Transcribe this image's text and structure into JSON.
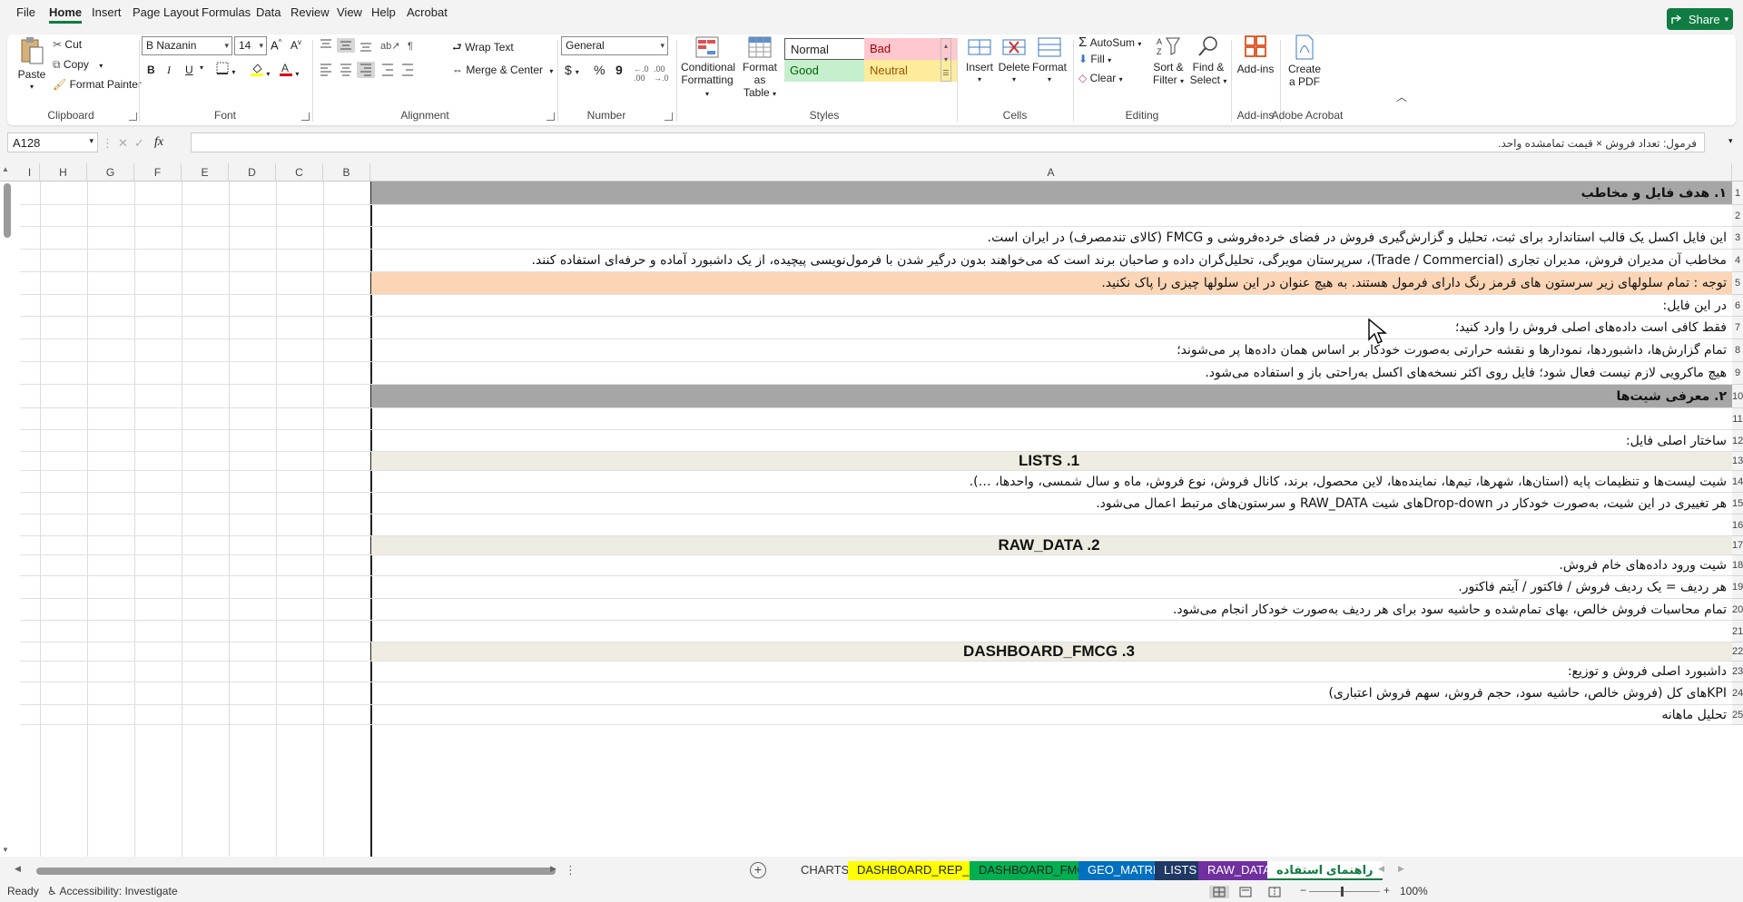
{
  "menu": [
    "File",
    "Home",
    "Insert",
    "Page Layout",
    "Formulas",
    "Data",
    "Review",
    "View",
    "Help",
    "Acrobat"
  ],
  "share_label": "Share",
  "ribbon": {
    "clipboard": {
      "paste": "Paste",
      "cut": "Cut",
      "copy": "Copy",
      "format_painter": "Format Painter",
      "label": "Clipboard"
    },
    "font": {
      "name": "B Nazanin",
      "size": "14",
      "bold": "B",
      "italic": "I",
      "underline": "U",
      "label": "Font"
    },
    "alignment": {
      "wrap": "Wrap Text",
      "merge": "Merge & Center",
      "label": "Alignment"
    },
    "number": {
      "format": "General",
      "currency": "$",
      "percent": "%",
      "comma": "9",
      "label": "Number"
    },
    "styles": {
      "conditional": [
        "Conditional",
        "Formatting"
      ],
      "format_table": [
        "Format as",
        "Table"
      ],
      "normal": "Normal",
      "bad": "Bad",
      "good": "Good",
      "neutral": "Neutral",
      "label": "Styles"
    },
    "cells": {
      "insert": "Insert",
      "delete": "Delete",
      "format": "Format",
      "label": "Cells"
    },
    "editing": {
      "autosum": "AutoSum",
      "fill": "Fill",
      "clear": "Clear",
      "sort": [
        "Sort &",
        "Filter"
      ],
      "find": [
        "Find &",
        "Select"
      ],
      "label": "Editing"
    },
    "addins": {
      "button": "Add-ins",
      "label": "Add-ins"
    },
    "acrobat": {
      "button": [
        "Create",
        "a PDF"
      ],
      "label": "Adobe Acrobat"
    }
  },
  "formula_bar": {
    "name_box": "A128",
    "fx": "fx",
    "content": "فرمول: تعداد فروش × قیمت تمامشده واحد."
  },
  "columns": [
    "I",
    "H",
    "G",
    "F",
    "E",
    "D",
    "C",
    "B",
    "A"
  ],
  "rows": [
    {
      "n": "1",
      "text": "۱. هدف فایل و مخاطب",
      "style": "dark"
    },
    {
      "n": "2",
      "text": "",
      "style": ""
    },
    {
      "n": "3",
      "text": "این فایل اکسل یک قالب استاندارد برای ثبت، تحلیل و گزارش‌گیری فروش در فضای خرده‌فروشی و FMCG (کالای تندمصرف) در ایران است.",
      "style": ""
    },
    {
      "n": "4",
      "text": "مخاطب آن مدیران فروش، مدیران تجاری (Trade / Commercial)، سرپرستان مویرگی، تحلیل‌گران داده و صاحبان برند است که می‌خواهند بدون درگیر شدن با فرمول‌نویسی پیچیده، از یک داشبورد آماده و حرفه‌ای استفاده کنند.",
      "style": ""
    },
    {
      "n": "5",
      "text": "توجه : تمام سلولهای زیر سرستون های قرمز رنگ دارای فرمول هستند. به هیچ عنوان در این سلولها چیزی را پاک نکنید.",
      "style": "orange"
    },
    {
      "n": "6",
      "text": "در این فایل:",
      "style": ""
    },
    {
      "n": "7",
      "text": "فقط کافی است داده‌های اصلی فروش را وارد کنید؛",
      "style": ""
    },
    {
      "n": "8",
      "text": "تمام گزارش‌ها، داشبوردها، نمودارها و نقشه حرارتی به‌صورت خودکار بر اساس همان داده‌ها پر می‌شوند؛",
      "style": ""
    },
    {
      "n": "9",
      "text": "هیچ ماکرویی لازم نیست فعال شود؛ فایل روی اکثر نسخه‌های اکسل به‌راحتی باز و استفاده می‌شود.",
      "style": ""
    },
    {
      "n": "10",
      "text": "۲. معرفی شیت‌ها",
      "style": "dark"
    },
    {
      "n": "11",
      "text": "",
      "style": ""
    },
    {
      "n": "12",
      "text": "ساختار اصلی فایل:",
      "style": ""
    },
    {
      "n": "13",
      "text": "LISTS .1",
      "style": "title"
    },
    {
      "n": "14",
      "text": "شیت لیست‌ها و تنظیمات پایه (استان‌ها، شهرها، تیم‌ها، نماینده‌ها، لاین محصول، برند، کانال فروش، نوع فروش، ماه و سال شمسی، واحدها، …).",
      "style": ""
    },
    {
      "n": "15",
      "text": "هر تغییری در این شیت، به‌صورت خودکار در Drop-downهای شیت RAW_DATA و سرستون‌های مرتبط اعمال می‌شود.",
      "style": ""
    },
    {
      "n": "16",
      "text": "",
      "style": ""
    },
    {
      "n": "17",
      "text": "RAW_DATA .2",
      "style": "title"
    },
    {
      "n": "18",
      "text": "شیت ورود داده‌های خام فروش.",
      "style": ""
    },
    {
      "n": "19",
      "text": "هر ردیف = یک ردیف فروش / فاکتور / آیتم فاکتور.",
      "style": ""
    },
    {
      "n": "20",
      "text": "تمام محاسبات فروش خالص، بهای تمام‌شده و حاشیه سود برای هر ردیف به‌صورت خودکار انجام می‌شود.",
      "style": ""
    },
    {
      "n": "21",
      "text": "",
      "style": ""
    },
    {
      "n": "22",
      "text": "DASHBOARD_FMCG .3",
      "style": "title"
    },
    {
      "n": "23",
      "text": "داشبورد اصلی فروش و توزیع:",
      "style": ""
    },
    {
      "n": "24",
      "text": "KPIهای کل (فروش خالص، حاشیه سود، حجم فروش، سهم فروش اعتباری)",
      "style": ""
    },
    {
      "n": "25",
      "text": "تحلیل ماهانه",
      "style": ""
    }
  ],
  "sheet_tabs": [
    {
      "label": "CHARTS",
      "bg": "#f3f3f3",
      "fg": "#333333"
    },
    {
      "label": "DASHBOARD_REP_CITY",
      "bg": "#ffff00",
      "fg": "#222222"
    },
    {
      "label": "DASHBOARD_FMCG",
      "bg": "#00b050",
      "fg": "#222222"
    },
    {
      "label": "GEO_MATRIX",
      "bg": "#0070c0",
      "fg": "#ffffff"
    },
    {
      "label": "LISTS",
      "bg": "#1f3864",
      "fg": "#ffffff"
    },
    {
      "label": "RAW_DATA",
      "bg": "#7030a0",
      "fg": "#ffffff"
    },
    {
      "label": "راهنمای استفاده",
      "bg": "#ffffff",
      "fg": "#107c41"
    }
  ],
  "status": {
    "ready": "Ready",
    "accessibility": "Accessibility: Investigate",
    "zoom": "100%"
  },
  "colors": {
    "accent": "#107c41",
    "header_dark": "#a6a6a6",
    "header_light": "#eeece1",
    "warning": "#fbd5b5"
  }
}
